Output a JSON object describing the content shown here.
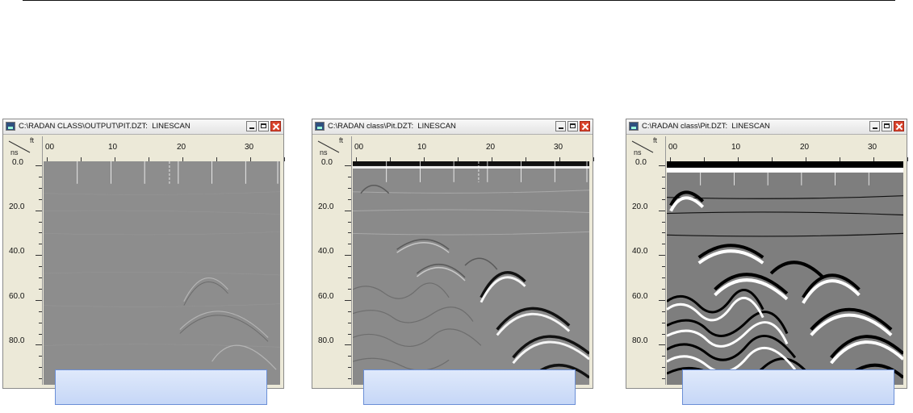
{
  "windows": [
    {
      "title": "C:\\RADAN CLASS\\OUTPUT\\PIT.DZT:  LINESCAN",
      "ruler": {
        "corner_top": "ft",
        "corner_bottom": "ns",
        "x_ticks": [
          "00",
          "10",
          "20",
          "30"
        ],
        "y_ticks": [
          "0.0",
          "20.0",
          "40.0",
          "60.0",
          "80.0"
        ]
      },
      "contrast": "low"
    },
    {
      "title": "C:\\RADAN class\\Pit.DZT:  LINESCAN",
      "ruler": {
        "corner_top": "ft",
        "corner_bottom": "ns",
        "x_ticks": [
          "00",
          "10",
          "20",
          "30"
        ],
        "y_ticks": [
          "0.0",
          "20.0",
          "40.0",
          "60.0",
          "80.0"
        ]
      },
      "contrast": "medium"
    },
    {
      "title": "C:\\RADAN class\\Pit.DZT:  LINESCAN",
      "ruler": {
        "corner_top": "ft",
        "corner_bottom": "ns",
        "x_ticks": [
          "00",
          "10",
          "20",
          "30"
        ],
        "y_ticks": [
          "0.0",
          "20.0",
          "40.0",
          "60.0",
          "80.0"
        ]
      },
      "contrast": "high"
    }
  ],
  "colors": {
    "label_box_fill": "#c6d7f7",
    "label_box_border": "#6b8fd6",
    "close_button": "#d9432c"
  }
}
